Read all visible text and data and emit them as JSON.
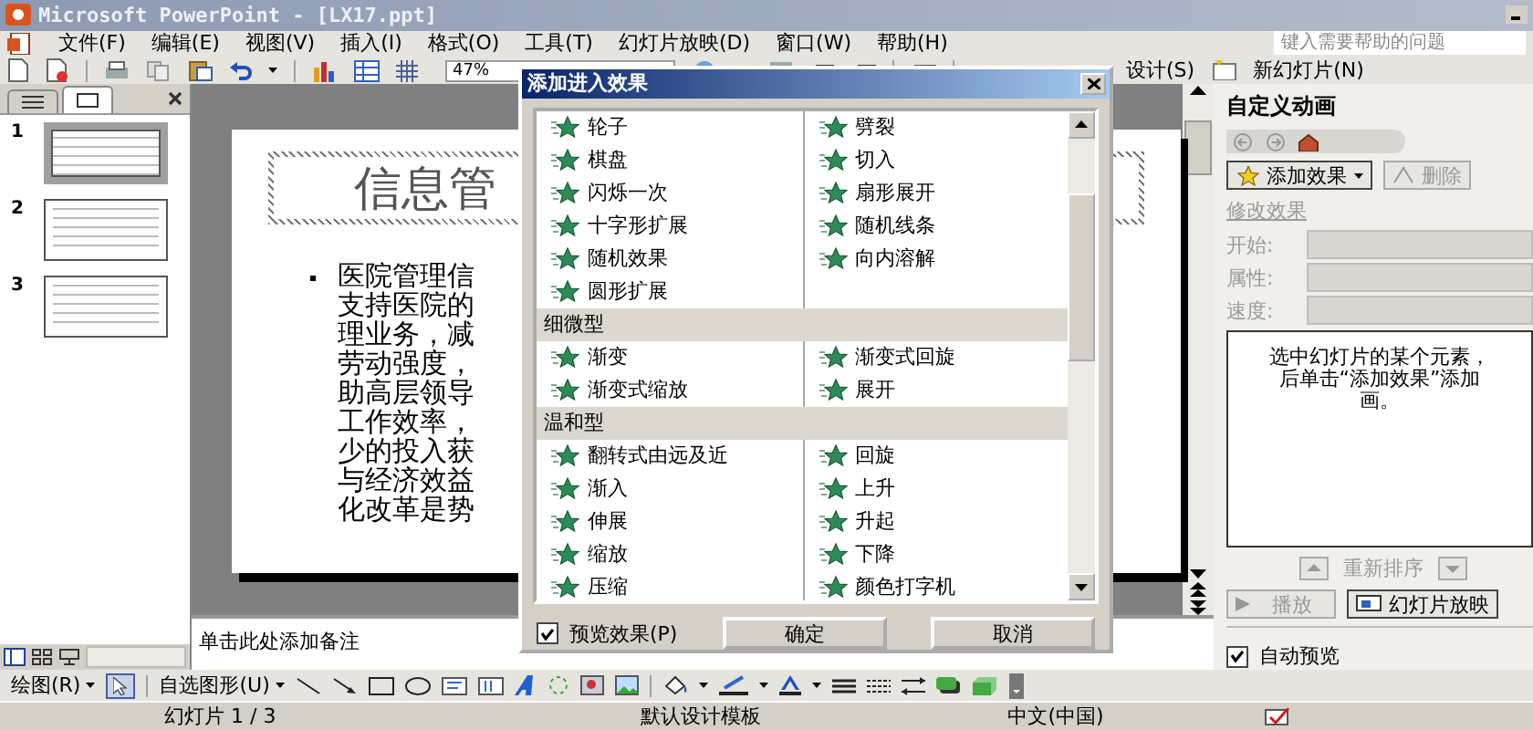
{
  "window": {
    "title": "Microsoft PowerPoint - [LX17.ppt]"
  },
  "menu": [
    "文件(F)",
    "编辑(E)",
    "视图(V)",
    "插入(I)",
    "格式(O)",
    "工具(T)",
    "幻灯片放映(D)",
    "窗口(W)",
    "帮助(H)"
  ],
  "help_search": {
    "placeholder": "键入需要帮助的问题"
  },
  "toolbar": {
    "zoom": "47%",
    "design_button": "设计(S)",
    "new_slide_button": "新幻灯片(N)"
  },
  "slides_panel": {
    "tabs": [
      {
        "kind": "outline",
        "selected": false
      },
      {
        "kind": "slides",
        "selected": true
      }
    ],
    "thumbnails": [
      {
        "number": "1",
        "selected": true
      },
      {
        "number": "2",
        "selected": false
      },
      {
        "number": "3",
        "selected": false
      }
    ]
  },
  "slide": {
    "title": "信息管",
    "bullet_lines": [
      "医院管理信",
      "支持医院的",
      "理业务，减",
      "劳动强度，",
      "助高层领导",
      "工作效率，",
      "少的投入获",
      "与经济效益",
      "化改革是势"
    ]
  },
  "notes": {
    "text": "单击此处添加备注"
  },
  "task_pane": {
    "title": "自定义动画",
    "add_effect_button": "添加效果",
    "remove_button": {
      "label": "删除",
      "disabled": true
    },
    "section": "修改效果",
    "fields": [
      {
        "label": "开始:",
        "disabled": true
      },
      {
        "label": "属性:",
        "disabled": true
      },
      {
        "label": "速度:",
        "disabled": true
      }
    ],
    "hint": "选中幻灯片的某个元素，后单击“添加效果”添加画。",
    "reorder": {
      "label": "重新排序",
      "disabled": true
    },
    "play_button": {
      "label": "播放",
      "disabled": true
    },
    "slideshow_button": "幻灯片放映",
    "auto_preview": {
      "label": "自动预览",
      "checked": true
    }
  },
  "dialog": {
    "title": "添加进入效果",
    "groups": [
      {
        "items": [
          "轮子",
          "劈裂",
          "棋盘",
          "切入",
          "闪烁一次",
          "扇形展开",
          "十字形扩展",
          "随机线条",
          "随机效果",
          "向内溶解",
          "圆形扩展"
        ]
      },
      {
        "header": "细微型",
        "items": [
          "渐变",
          "渐变式回旋",
          "渐变式缩放",
          "展开"
        ]
      },
      {
        "header": "温和型",
        "items": [
          "翻转式由远及近",
          "回旋",
          "渐入",
          "上升",
          "伸展",
          "升起",
          "缩放",
          "下降",
          "压缩",
          "颜色打字机"
        ]
      }
    ],
    "preview": {
      "label": "预览效果(P)",
      "checked": true
    },
    "buttons": [
      "确定",
      "取消"
    ]
  },
  "draw_toolbar": {
    "draw_menu": "绘图(R)",
    "autoshapes_menu": "自选图形(U)"
  },
  "status_bar": {
    "slide": "幻灯片 1 / 3",
    "template": "默认设计模板",
    "language": "中文(中国)"
  }
}
